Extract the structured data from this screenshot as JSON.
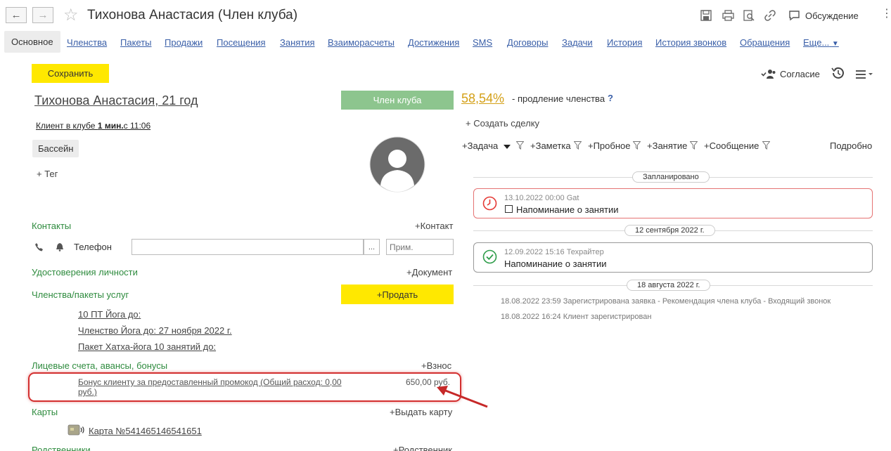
{
  "window": {
    "title": "Тихонова Анастасия (Член клуба)",
    "discussion_label": "Обсуждение",
    "more_icon": "more-vert-icon"
  },
  "tabs": [
    {
      "label": "Основное"
    },
    {
      "label": "Членства"
    },
    {
      "label": "Пакеты"
    },
    {
      "label": "Продажи"
    },
    {
      "label": "Посещения"
    },
    {
      "label": "Занятия"
    },
    {
      "label": "Взаиморасчеты"
    },
    {
      "label": "Достижения"
    },
    {
      "label": "SMS"
    },
    {
      "label": "Договоры"
    },
    {
      "label": "Задачи"
    },
    {
      "label": "История"
    },
    {
      "label": "История звонков"
    },
    {
      "label": "Обращения"
    },
    {
      "label": "Еще..."
    }
  ],
  "toolbar": {
    "save_label": "Сохранить",
    "consent_label": "Согласие"
  },
  "client": {
    "name_age": "Тихонова Анастасия, 21 год",
    "status_label": "Член клуба",
    "in_club_prefix": "Клиент в клубе ",
    "in_club_duration": "1 мин.",
    "in_club_suffix": "с 11:06",
    "tag": "Бассейн",
    "add_tag": "+ Тег"
  },
  "contacts": {
    "section": "Контакты",
    "add": "+Контакт",
    "phone_label": "Телефон",
    "phone_value": "",
    "choose_btn": "...",
    "note_placeholder": "Прим."
  },
  "documents": {
    "section": "Удостоверения личности",
    "add": "+Документ"
  },
  "memberships": {
    "section": "Членства/пакеты услуг",
    "sell_label": "+Продать",
    "items": [
      "10 ПТ Йога до:",
      "Членство Йога до: 27 ноября 2022 г.",
      "Пакет Хатха-йога 10 занятий до:"
    ]
  },
  "accounts": {
    "section": "Лицевые счета, авансы, бонусы",
    "add": "+Взнос",
    "bonus_line1": "Бонус клиенту за предоставленный промокод (Общий расход: 0,00",
    "bonus_line2": "руб.)",
    "bonus_amount": "650,00 руб."
  },
  "cards": {
    "section": "Карты",
    "add": "+Выдать карту",
    "card_label": "Карта №541465146541651"
  },
  "relatives": {
    "section": "Родственники",
    "add": "+Родственник"
  },
  "right": {
    "prolong_pct": "58,54%",
    "prolong_text": "- продление членства",
    "help": "?",
    "create_deal": "+ Создать сделку",
    "filters": [
      "+Задача",
      "+Заметка",
      "+Пробное",
      "+Занятие",
      "+Сообщение"
    ],
    "details": "Подробно",
    "groups": {
      "planned": "Запланировано",
      "sep12": "12 сентября 2022 г.",
      "aug18": "18 августа 2022 г."
    },
    "event1_meta": "13.10.2022 00:00 Gat",
    "event1_text": "Напоминание о занятии",
    "event2_meta": "12.09.2022 15:16 Техрайтер",
    "event2_text": "Напоминание о занятии",
    "log1": "18.08.2022 23:59 Зарегистрирована заявка - Рекомендация члена клуба - Входящий звонок",
    "log2": "18.08.2022 16:24 Клиент зарегистрирован"
  },
  "colors": {
    "accent_yellow": "#ffe800",
    "status_green": "#8dc58e",
    "section_green": "#2e8b3e",
    "highlight_red": "#d32f2f",
    "prolong_gold": "#d4a017"
  }
}
